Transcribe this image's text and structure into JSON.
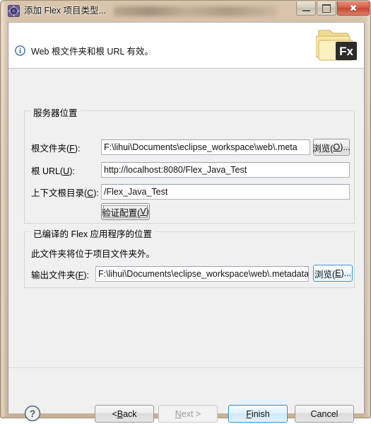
{
  "window": {
    "title": "添加 Flex 项目类型...",
    "title_icon": "flex-builder-icon",
    "minimize_label": "最小化",
    "maximize_label": "最大化",
    "close_label": "关闭"
  },
  "banner": {
    "icon": "info-icon",
    "message": "Web 根文件夹和根 URL 有效。",
    "art_icon": "folder-fx-icon",
    "art_badge": "Fx"
  },
  "server_group": {
    "title": "服务器位置",
    "root_folder": {
      "label": "根文件夹(F):",
      "accel": "F",
      "value": "F:\\lihui\\Documents\\eclipse_workspace\\web\\.meta",
      "browse_label": "浏览(O)...",
      "browse_accel": "O"
    },
    "root_url": {
      "label": "根 URL(U):",
      "accel": "U",
      "value": "http://localhost:8080/Flex_Java_Test"
    },
    "context_root": {
      "label": "上下文根目录(C):",
      "accel": "C",
      "value": "/Flex_Java_Test"
    },
    "validate_button": {
      "label": "验证配置(V)",
      "accel": "V"
    }
  },
  "output_group": {
    "title": "已编译的 Flex 应用程序的位置",
    "description": "此文件夹将位于项目文件夹外。",
    "output_folder": {
      "label": "输出文件夹(F):",
      "accel": "F",
      "value": "F:\\lihui\\Documents\\eclipse_workspace\\web\\.metadata",
      "browse_label": "浏览(E)...",
      "browse_accel": "E"
    }
  },
  "footer": {
    "help_icon": "help-question-icon",
    "back_label": "< Back",
    "back_accel": "B",
    "next_label": "Next >",
    "next_accel": "N",
    "finish_label": "Finish",
    "finish_accel": "F",
    "cancel_label": "Cancel"
  },
  "colors": {
    "frame": "#cbb79c",
    "dialog_bg": "#f0f0f0",
    "banner_bg": "#ffffff",
    "accent_blue": "#2a8ad4",
    "close_red": "#c44a33",
    "folder_yellow": "#f2d98a"
  }
}
